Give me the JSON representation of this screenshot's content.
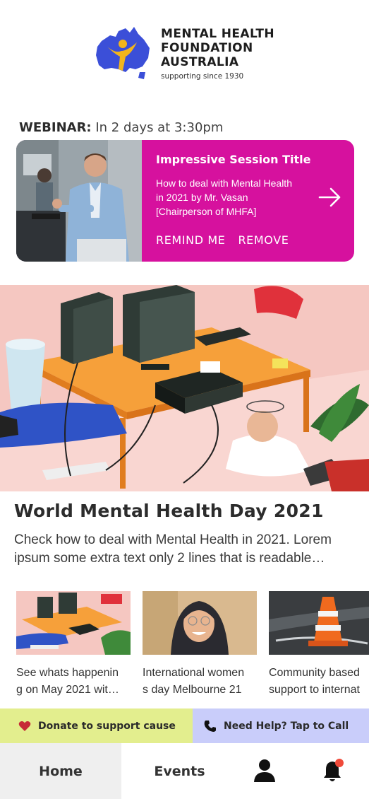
{
  "brand": {
    "line1": "MENTAL HEALTH",
    "line2": "FOUNDATION",
    "line3": "AUSTRALIA",
    "tagline": "supporting since 1930",
    "colors": {
      "map": "#3b4fd8",
      "figure": "#f2b51b"
    }
  },
  "webinar": {
    "label": "WEBINAR:",
    "when": " In 2 days at 3:30pm",
    "title": "Impressive Session Title",
    "description": "How to deal with Mental Health in 2021 by Mr. Vasan [Chairperson of MHFA]",
    "remind_label": "REMIND ME",
    "remove_label": "REMOVE",
    "card_color": "#d6119e",
    "arrow_icon": "arrow-right-icon"
  },
  "hero": {
    "title": "World Mental Health Day 2021",
    "description": "Check how to deal with Mental Health in 2021. Lorem ipsum some extra text only 2 lines that is readable…"
  },
  "cards": [
    {
      "line1": "See whats happenin",
      "line2": "g on May 2021 wit…"
    },
    {
      "line1": "International women",
      "line2": "s day Melbourne 21"
    },
    {
      "line1": "Community based",
      "line2": "support to internat"
    }
  ],
  "actions": {
    "donate_label": "Donate to support cause",
    "donate_icon": "heart-icon",
    "donate_color": "#e3ee8e",
    "help_label": "Need Help? Tap to Call",
    "help_icon": "phone-icon",
    "help_color": "#c9cdfa"
  },
  "nav": {
    "home_label": "Home",
    "events_label": "Events",
    "profile_icon": "user-icon",
    "notifications_icon": "bell-icon",
    "notification_dot_color": "#f04a3a"
  }
}
